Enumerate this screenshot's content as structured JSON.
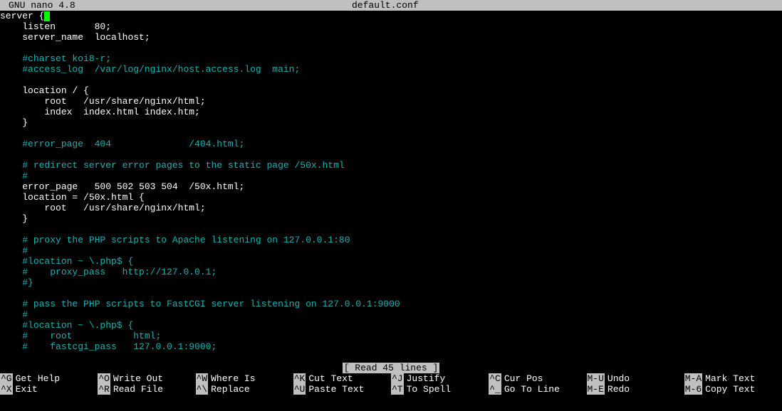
{
  "titlebar": {
    "app": "GNU nano 4.8",
    "filename": "default.conf"
  },
  "status": "[ Read 45 lines ]",
  "file_lines": [
    {
      "t": "server {",
      "c": "white",
      "cursor_after": true
    },
    {
      "t": "    listen       80;",
      "c": "white"
    },
    {
      "t": "    server_name  localhost;",
      "c": "white"
    },
    {
      "t": "",
      "c": "white"
    },
    {
      "t": "    #charset koi8-r;",
      "c": "cyan"
    },
    {
      "t": "    #access_log  /var/log/nginx/host.access.log  main;",
      "c": "cyan"
    },
    {
      "t": "",
      "c": "white"
    },
    {
      "t": "    location / {",
      "c": "white"
    },
    {
      "t": "        root   /usr/share/nginx/html;",
      "c": "white"
    },
    {
      "t": "        index  index.html index.htm;",
      "c": "white"
    },
    {
      "t": "    }",
      "c": "white"
    },
    {
      "t": "",
      "c": "white"
    },
    {
      "t": "    #error_page  404              /404.html;",
      "c": "cyan"
    },
    {
      "t": "",
      "c": "white"
    },
    {
      "t": "    # redirect server error pages to the static page /50x.html",
      "c": "cyan"
    },
    {
      "t": "    #",
      "c": "cyan"
    },
    {
      "t": "    error_page   500 502 503 504  /50x.html;",
      "c": "white"
    },
    {
      "t": "    location = /50x.html {",
      "c": "white"
    },
    {
      "t": "        root   /usr/share/nginx/html;",
      "c": "white"
    },
    {
      "t": "    }",
      "c": "white"
    },
    {
      "t": "",
      "c": "white"
    },
    {
      "t": "    # proxy the PHP scripts to Apache listening on 127.0.0.1:80",
      "c": "cyan"
    },
    {
      "t": "    #",
      "c": "cyan"
    },
    {
      "t": "    #location ~ \\.php$ {",
      "c": "cyan"
    },
    {
      "t": "    #    proxy_pass   http://127.0.0.1;",
      "c": "cyan"
    },
    {
      "t": "    #}",
      "c": "cyan"
    },
    {
      "t": "",
      "c": "white"
    },
    {
      "t": "    # pass the PHP scripts to FastCGI server listening on 127.0.0.1:9000",
      "c": "cyan"
    },
    {
      "t": "    #",
      "c": "cyan"
    },
    {
      "t": "    #location ~ \\.php$ {",
      "c": "cyan"
    },
    {
      "t": "    #    root           html;",
      "c": "cyan"
    },
    {
      "t": "    #    fastcgi_pass   127.0.0.1:9000;",
      "c": "cyan"
    }
  ],
  "shortcuts_row1": [
    {
      "key": "^G",
      "label": "Get Help"
    },
    {
      "key": "^O",
      "label": "Write Out"
    },
    {
      "key": "^W",
      "label": "Where Is"
    },
    {
      "key": "^K",
      "label": "Cut Text"
    },
    {
      "key": "^J",
      "label": "Justify"
    },
    {
      "key": "^C",
      "label": "Cur Pos"
    },
    {
      "key": "M-U",
      "label": "Undo"
    },
    {
      "key": "M-A",
      "label": "Mark Text"
    }
  ],
  "shortcuts_row2": [
    {
      "key": "^X",
      "label": "Exit"
    },
    {
      "key": "^R",
      "label": "Read File"
    },
    {
      "key": "^\\",
      "label": "Replace"
    },
    {
      "key": "^U",
      "label": "Paste Text"
    },
    {
      "key": "^T",
      "label": "To Spell"
    },
    {
      "key": "^_",
      "label": "Go To Line"
    },
    {
      "key": "M-E",
      "label": "Redo"
    },
    {
      "key": "M-6",
      "label": "Copy Text"
    }
  ]
}
